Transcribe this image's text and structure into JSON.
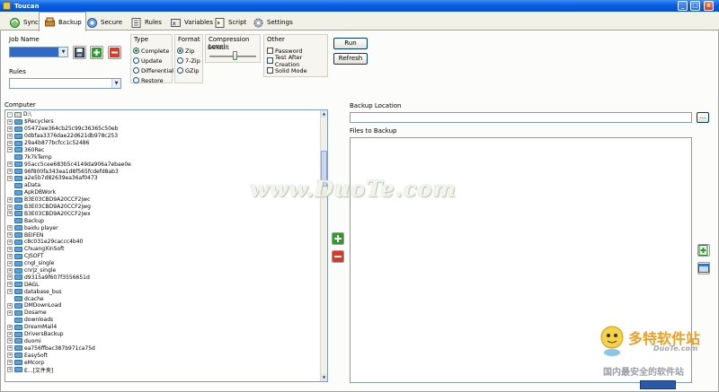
{
  "window": {
    "title": "Toucan",
    "min": "_",
    "max": "□",
    "close": "×"
  },
  "tabs": [
    {
      "label": "Sync",
      "icon": "sync-icon"
    },
    {
      "label": "Backup",
      "icon": "backup-icon"
    },
    {
      "label": "Secure",
      "icon": "secure-icon"
    },
    {
      "label": "Rules",
      "icon": "rules-icon"
    },
    {
      "label": "Variables",
      "icon": "variables-icon"
    },
    {
      "label": "Script",
      "icon": "script-icon"
    },
    {
      "label": "Settings",
      "icon": "settings-icon"
    }
  ],
  "job": {
    "label": "Job Name",
    "value": ""
  },
  "rules": {
    "label": "Rules",
    "value": ""
  },
  "type": {
    "label": "Type",
    "options": [
      "Complete",
      "Update",
      "Differential",
      "Restore"
    ],
    "selected": "Complete"
  },
  "format": {
    "label": "Format",
    "options": [
      "Zip",
      "7-Zip",
      "GZip"
    ],
    "selected": "Zip"
  },
  "compression": {
    "label": "Compression Level",
    "value": "Default"
  },
  "other": {
    "label": "Other",
    "options": [
      "Password",
      "Test After Creation",
      "Solid Mode"
    ]
  },
  "actions": {
    "run": "Run",
    "refresh": "Refresh"
  },
  "computer": {
    "label": "Computer"
  },
  "tree": [
    {
      "name": "D:\\",
      "drive": true,
      "exp": "-"
    },
    {
      "name": "$Recyclers",
      "exp": "+"
    },
    {
      "name": "05472ee364cb25c99c36365c50eb",
      "exp": "+"
    },
    {
      "name": "0dbfaa3376dae22d621db978c253",
      "exp": "+"
    },
    {
      "name": "29a4b877bcfcc1c52486",
      "exp": "+"
    },
    {
      "name": "360Rec",
      "exp": "+"
    },
    {
      "name": "7k7kTemp",
      "exp": ""
    },
    {
      "name": "95acc5cee683b5c4149da906a7ebae0e",
      "exp": "+"
    },
    {
      "name": "96f800fa343ea1d8f565fcdefd8ab3",
      "exp": "+"
    },
    {
      "name": "a2e5b7d82639ea36af0473",
      "exp": "+"
    },
    {
      "name": "aData",
      "exp": ""
    },
    {
      "name": "ApkDBWork",
      "exp": ""
    },
    {
      "name": "B3E03CBD9A20CCF2jwc",
      "exp": "+"
    },
    {
      "name": "B3E03CBD9A20CCF2jwg",
      "exp": "+"
    },
    {
      "name": "B3E03CBD9A20CCF2jwx",
      "exp": "+"
    },
    {
      "name": "Backup",
      "exp": ""
    },
    {
      "name": "baidu player",
      "exp": "+"
    },
    {
      "name": "BEIFEN",
      "exp": "+"
    },
    {
      "name": "c8c031e29caccc4b40",
      "exp": "+"
    },
    {
      "name": "ChuangXinSoft",
      "exp": "+"
    },
    {
      "name": "CJSOFT",
      "exp": "+"
    },
    {
      "name": "cngl_single",
      "exp": "+"
    },
    {
      "name": "cnrjz_single",
      "exp": "+"
    },
    {
      "name": "d9315a9f607f3556651d",
      "exp": "+"
    },
    {
      "name": "DAGL",
      "exp": "+"
    },
    {
      "name": "database_bus",
      "exp": "+"
    },
    {
      "name": "dcache",
      "exp": ""
    },
    {
      "name": "DMDownLoad",
      "exp": "+"
    },
    {
      "name": "Dosame",
      "exp": "+"
    },
    {
      "name": "downloads",
      "exp": ""
    },
    {
      "name": "DreamMail4",
      "exp": "+"
    },
    {
      "name": "DriversBackup",
      "exp": "+"
    },
    {
      "name": "duomi",
      "exp": "+"
    },
    {
      "name": "ea756ffbac387b971ca75d",
      "exp": "+"
    },
    {
      "name": "EasySoft",
      "exp": "+"
    },
    {
      "name": "eMcorp",
      "exp": "+"
    },
    {
      "name": "E...[文件夹]",
      "exp": "+"
    }
  ],
  "backup_location": {
    "label": "Backup Location",
    "value": "",
    "browse": "..."
  },
  "files_to_backup": {
    "label": "Files to Backup"
  },
  "watermark": {
    "text": "www.DuoTe.com",
    "logo_cn": "多特软件站",
    "logo_en": "DuoTe.com",
    "logo_sub": "国内最安全的软件站"
  },
  "colors": {
    "accent": "#316ac5",
    "titlebar": "#0a5ee0",
    "plus": "#2e9b2e",
    "minus": "#d83a2a"
  }
}
